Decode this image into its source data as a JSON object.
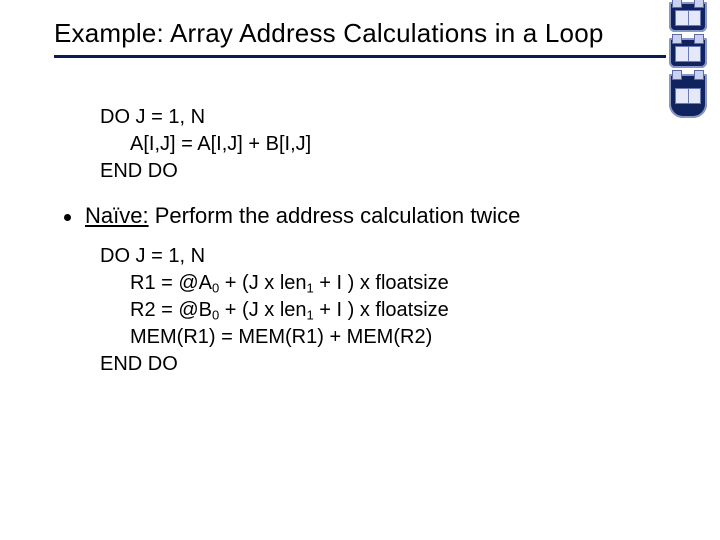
{
  "title": "Example: Array Address Calculations in a Loop",
  "code1": {
    "l1": "DO J = 1, N",
    "l2": "A[I,J] = A[I,J] + B[I,J]",
    "l3": "END DO"
  },
  "bullet": {
    "lead": "Naïve:",
    "rest": " Perform the address calculation twice"
  },
  "code2": {
    "l1": "DO J = 1, N",
    "l2a": "R1 = @A",
    "l2sub": "0",
    "l2b": " + (J x len",
    "l2sub2": "1",
    "l2c": " + I ) x floatsize",
    "l3a": "R2 = @B",
    "l3sub": "0",
    "l3b": " + (J x len",
    "l3sub2": "1",
    "l3c": " + I ) x floatsize",
    "l4": "MEM(R1) = MEM(R1) + MEM(R2)",
    "l5": "END DO"
  }
}
